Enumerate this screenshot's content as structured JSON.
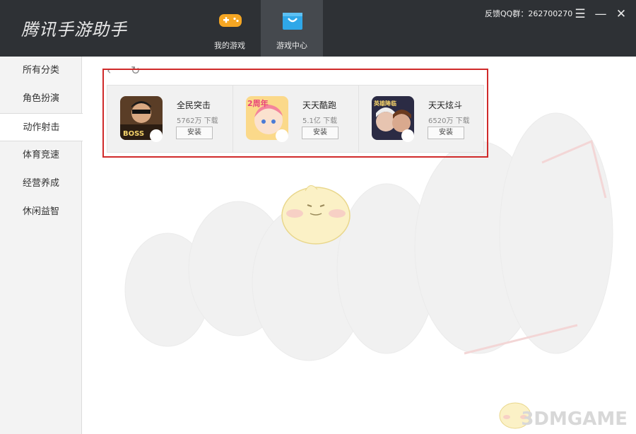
{
  "app": {
    "title": "腾讯手游助手"
  },
  "tabs": [
    {
      "label": "我的游戏",
      "icon": "gamepad-icon",
      "active": false
    },
    {
      "label": "游戏中心",
      "icon": "shopping-bag-icon",
      "active": true
    }
  ],
  "feedback": {
    "text": "反馈QQ群：262700270"
  },
  "window_controls": {
    "menu": "☰",
    "minimize": "—",
    "close": "✕"
  },
  "sidebar": {
    "header": "所有分类",
    "items": [
      {
        "label": "角色扮演",
        "active": false
      },
      {
        "label": "动作射击",
        "active": true
      },
      {
        "label": "体育竞速",
        "active": false
      },
      {
        "label": "经营养成",
        "active": false
      },
      {
        "label": "休闲益智",
        "active": false
      }
    ]
  },
  "toolbar": {
    "back": "‹",
    "refresh": "↻"
  },
  "games": [
    {
      "name": "全民突击",
      "downloads": "5762万 下载",
      "install": "安装",
      "badge_text": "BOSS",
      "accent": "#6b4a2a"
    },
    {
      "name": "天天酷跑",
      "downloads": "5.1亿 下载",
      "install": "安装",
      "badge_text": "2周年",
      "accent": "#f6b24c"
    },
    {
      "name": "天天炫斗",
      "downloads": "6520万 下载",
      "install": "安装",
      "badge_text": "英雄降临",
      "accent": "#2b2b44"
    }
  ],
  "watermark": {
    "text": "3DMGAME"
  },
  "colors": {
    "titlebar": "#2e3135",
    "active_tab": "#45494e",
    "highlight": "#d02a2a",
    "tab_icon": "#f5a623",
    "bag_icon": "#2fa7e8"
  }
}
